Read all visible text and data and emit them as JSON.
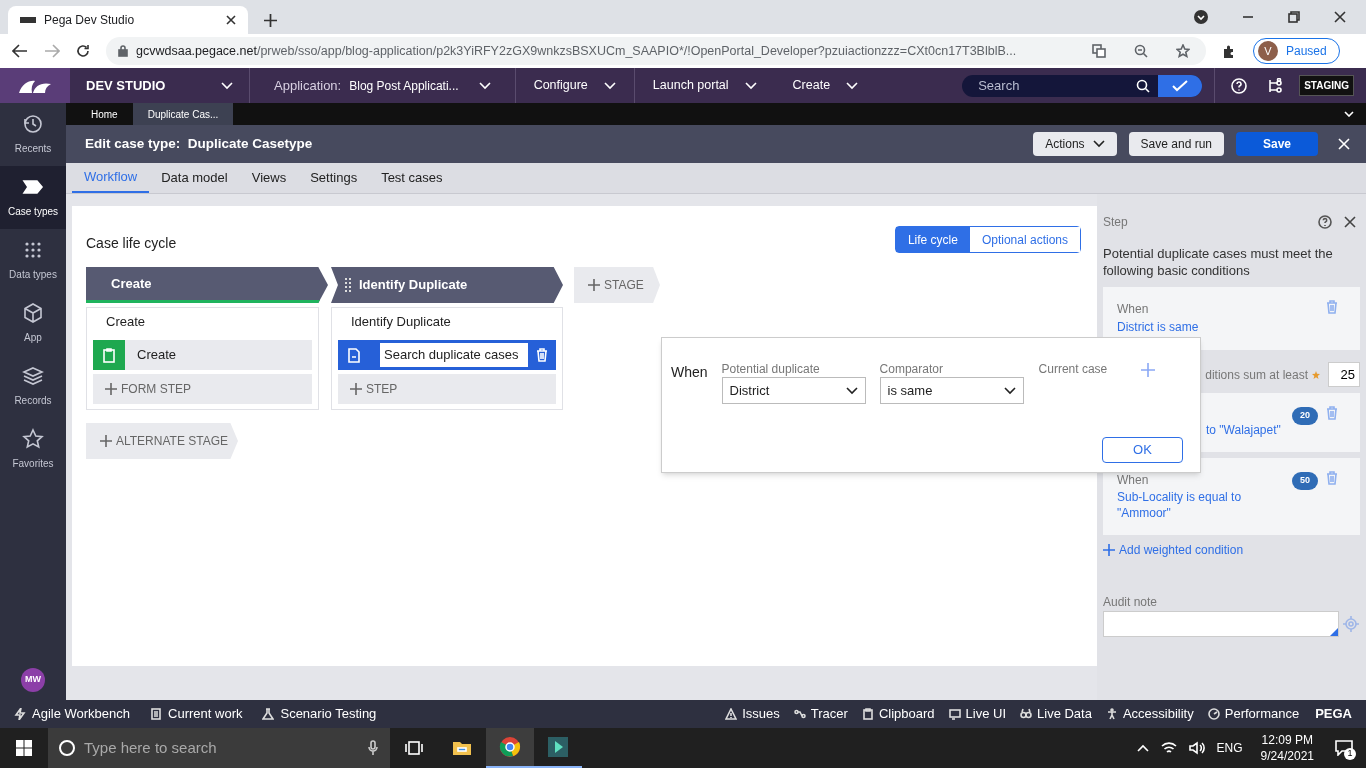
{
  "browser": {
    "tab": {
      "title": "Pega Dev Studio"
    },
    "url": {
      "host": "gcvwdsaa.pegace.net",
      "path": "/prweb/sso/app/blog-application/p2k3YiRFY2zGX9wnkzsBSXUCm_SAAPIO*/!OpenPortal_Developer?pzuiactionzzz=CXt0cn17T3BlblB..."
    },
    "profile": {
      "initial": "V",
      "label": "Paused"
    }
  },
  "header": {
    "brand": "DEV STUDIO",
    "application_label": "Application:",
    "application": "Blog Post Applicati...",
    "menus": [
      "Configure",
      "Launch portal",
      "Create"
    ],
    "search": {
      "placeholder": "Search"
    },
    "environment": "STAGING"
  },
  "sidebar": {
    "items": [
      {
        "label": "Recents",
        "selected": false
      },
      {
        "label": "Case types",
        "selected": true
      },
      {
        "label": "Data types",
        "selected": false
      },
      {
        "label": "App",
        "selected": false
      },
      {
        "label": "Records",
        "selected": false
      },
      {
        "label": "Favorites",
        "selected": false
      }
    ],
    "user": "MW"
  },
  "doc_tabs": [
    {
      "label": "Home",
      "selected": false
    },
    {
      "label": "Duplicate Cas...",
      "selected": true
    }
  ],
  "case_header": {
    "title": "Edit case type:  Duplicate Casetype",
    "buttons": [
      {
        "label": "Actions",
        "kind": "menu"
      },
      {
        "label": "Save and run",
        "kind": "secondary"
      },
      {
        "label": "Save",
        "kind": "primary"
      }
    ]
  },
  "subtabs": [
    {
      "label": "Workflow",
      "selected": true
    },
    {
      "label": "Data model",
      "selected": false
    },
    {
      "label": "Views",
      "selected": false
    },
    {
      "label": "Settings",
      "selected": false
    },
    {
      "label": "Test cases",
      "selected": false
    }
  ],
  "canvas": {
    "title": "Case life cycle",
    "view_toggle": [
      {
        "label": "Life cycle",
        "selected": true
      },
      {
        "label": "Optional actions",
        "selected": false
      }
    ],
    "stages": [
      {
        "name": "Create",
        "selected": true,
        "process": "Create",
        "steps": [
          {
            "kind": "form",
            "label": "Create",
            "selected": false
          }
        ],
        "add_step": "FORM STEP"
      },
      {
        "name": "Identify Duplicate",
        "selected": false,
        "process": "Identify Duplicate",
        "steps": [
          {
            "kind": "search",
            "label": "Search duplicate cases",
            "selected": true
          }
        ],
        "add_step": "STEP"
      }
    ],
    "add_stage": "STAGE",
    "add_alternate_stage": "ALTERNATE STAGE"
  },
  "condition_popup": {
    "when": "When",
    "fields": [
      {
        "label": "Potential duplicate",
        "value": "District"
      },
      {
        "label": "Comparator",
        "value": "is same"
      }
    ],
    "current_case_label": "Current case",
    "ok": "OK"
  },
  "step_panel": {
    "title": "Step",
    "intro": "Potential duplicate cases must meet the following basic conditions",
    "basic_conditions": [
      {
        "when": "When",
        "text": "District is same"
      }
    ],
    "weighted_label": "ditions sum at least",
    "threshold": "25",
    "weighted_conditions": [
      {
        "text": "to \"Walajapet\"",
        "weight": "20"
      },
      {
        "when": "When",
        "text": "Sub-Locality is equal to \"Ammoor\"",
        "weight": "50"
      }
    ],
    "add_condition": "Add weighted condition",
    "audit_label": "Audit note"
  },
  "dev_toolbar": {
    "left": [
      "Agile Workbench",
      "Current work",
      "Scenario Testing"
    ],
    "right": [
      "Issues",
      "Tracer",
      "Clipboard",
      "Live UI",
      "Live Data",
      "Accessibility",
      "Performance"
    ],
    "brand": "PEGA"
  },
  "taskbar": {
    "search": {
      "placeholder": "Type here to search"
    },
    "language": "ENG",
    "time": "12:09 PM",
    "date": "9/24/2021",
    "notifications": "1"
  }
}
